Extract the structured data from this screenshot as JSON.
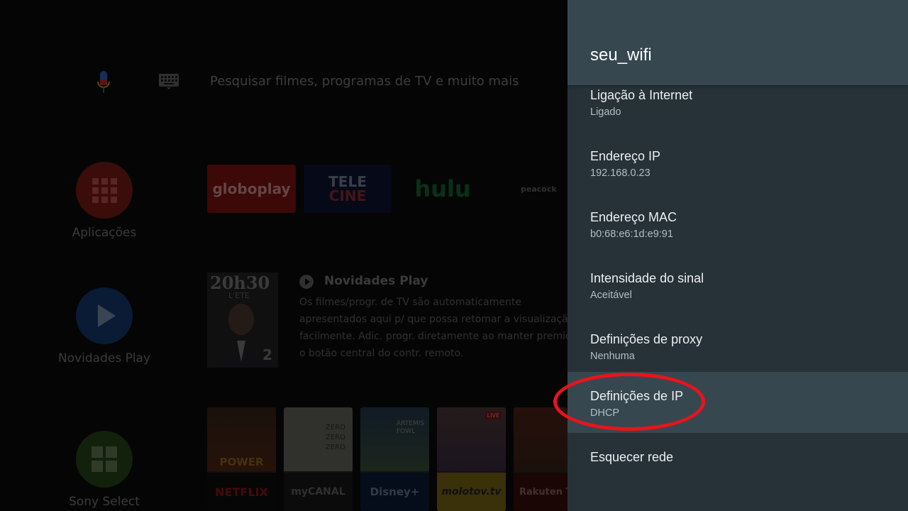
{
  "search": {
    "placeholder": "Pesquisar filmes, programas de TV e muito mais"
  },
  "sidebar": [
    {
      "label": "Aplicações",
      "icon": "apps-grid-icon"
    },
    {
      "label": "Novidades Play",
      "icon": "play-icon"
    },
    {
      "label": "Sony Select",
      "icon": "sony-select-icon"
    }
  ],
  "apps": [
    {
      "label": "globoplay"
    },
    {
      "label_top": "TELE",
      "label_bottom": "CINE"
    },
    {
      "label": "hulu"
    },
    {
      "label": "peacock"
    }
  ],
  "play_next": {
    "title": "Novidades Play",
    "description": "Os filmes/progr. de TV são automaticamente apresentados aqui p/ que possa retomar a visualização facilmente. Adic. progr. diretamente ao manter premido o botão central do contr. remoto.",
    "poster_title": "20h30",
    "poster_sub": "L'ETE",
    "poster_channel": "2"
  },
  "movies": [
    {
      "top_text": "POWER",
      "service": "NETFLIX"
    },
    {
      "top_text": "ZERO ZERO ZERO",
      "service": "myCANAL"
    },
    {
      "top_text": "ARTEMIS FOWL",
      "service": "Disney+"
    },
    {
      "top_text": "LIVE",
      "service": "molotov.tv"
    },
    {
      "top_text": "",
      "service": "Rakuten TV"
    }
  ],
  "panel": {
    "title": "seu_wifi",
    "items": [
      {
        "title": "Ligação à Internet",
        "subtitle": "Ligado"
      },
      {
        "title": "Endereço IP",
        "subtitle": "192.168.0.23"
      },
      {
        "title": "Endereço MAC",
        "subtitle": "b0:68:e6:1d:e9:91"
      },
      {
        "title": "Intensidade do sinal",
        "subtitle": "Aceitável"
      },
      {
        "title": "Definições de proxy",
        "subtitle": "Nenhuma"
      },
      {
        "title": "Definições de IP",
        "subtitle": "DHCP"
      },
      {
        "title": "Esquecer rede",
        "subtitle": ""
      }
    ]
  },
  "colors": {
    "panel_bg": "#263238",
    "panel_header": "#37474f",
    "focused_row": "#37474f",
    "annotation": "#e8141c"
  }
}
